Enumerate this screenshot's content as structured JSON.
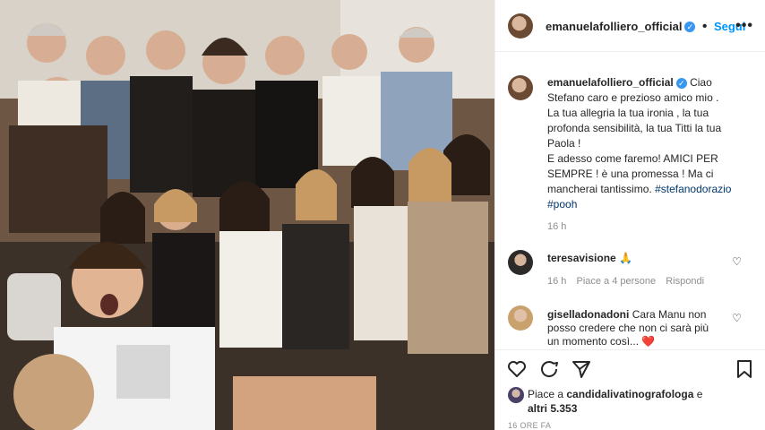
{
  "post": {
    "photo_alt": "",
    "header": {
      "username": "emanuelafolliero_official",
      "separator": "•",
      "follow_label": "Segui",
      "more_icon": "more-dots-icon"
    },
    "caption": {
      "username": "emanuelafolliero_official",
      "line1": "Ciao",
      "line2": "Stefano caro e prezioso amico mio .",
      "line3": "La tua allegria la tua ironia , la tua",
      "line4": "profonda sensibilità, la tua Titti la tua",
      "line5": "Paola !",
      "line6": "E adesso come faremo! AMICI PER",
      "line7": "SEMPRE ! è una promessa ! Ma ci",
      "line8": "mancherai tantissimo.",
      "hashtag1": "#stefanodorazio",
      "hashtag2": "#pooh",
      "time": "16 h"
    },
    "comments": [
      {
        "username": "teresavisione",
        "text": "🙏",
        "time": "16 h",
        "likes": "Piace a 4 persone",
        "reply": "Rispondi"
      },
      {
        "username": "giselladonadoni",
        "text_line1": "Cara Manu non",
        "text_line2": "posso credere che non ci sarà più",
        "text_line3": "un momento così...",
        "emoji": "❤️"
      }
    ],
    "likes": {
      "prefix": "Piace a",
      "user": "candidalivatinografologa",
      "suffix": "e",
      "others": "altri 5.353"
    },
    "timestamp": "16 ORE FA"
  },
  "colors": {
    "accent": "#0095f6",
    "verified": "#3897f0",
    "text": "#262626",
    "muted": "#8e8e8e",
    "heart_red": "#ed4956"
  }
}
